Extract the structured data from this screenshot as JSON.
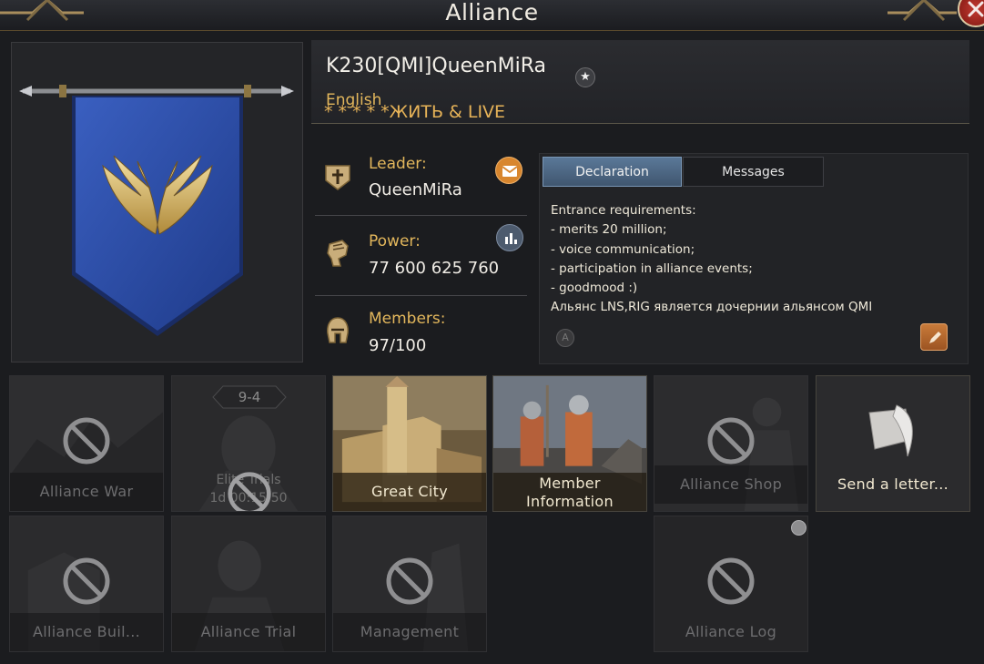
{
  "window": {
    "title": "Alliance"
  },
  "alliance": {
    "name": "K230[QMI]QueenMiRa",
    "language": "English",
    "motto": "* * * * *ЖИТЬ & LIVE"
  },
  "stats": {
    "leader_label": "Leader:",
    "leader_value": "QueenMiRa",
    "power_label": "Power:",
    "power_value": "77 600 625 760",
    "members_label": "Members:",
    "members_value": "97/100"
  },
  "info": {
    "tabs": [
      "Declaration",
      "Messages"
    ],
    "active_tab": "Declaration",
    "declaration_lines": [
      "Entrance requirements:",
      "- merits 20 million;",
      "- voice communication;",
      "- participation in alliance events;",
      "- goodmood :)",
      "Альянс LNS,RIG является дочернии альянсом QMI"
    ]
  },
  "features": [
    {
      "label": "Alliance War",
      "enabled": false
    },
    {
      "label": "Elite Trials",
      "badge": "9-4",
      "timer": "1d 00:15:50",
      "enabled": false
    },
    {
      "label": "Great City",
      "enabled": true
    },
    {
      "label": "Member Information",
      "enabled": true
    },
    {
      "label": "Alliance Shop",
      "enabled": false
    },
    {
      "label": "Send a letter...",
      "enabled": true
    },
    {
      "label": "Alliance Buil...",
      "enabled": false
    },
    {
      "label": "Alliance Trial",
      "enabled": false
    },
    {
      "label": "Management",
      "enabled": false
    },
    {
      "label": "Alliance Log",
      "enabled": false
    }
  ],
  "icons": {
    "close": "close-icon",
    "star": "star-icon",
    "leader": "leader-crest-icon",
    "mail": "mail-icon",
    "power": "fist-icon",
    "chart": "bar-chart-icon",
    "members": "helmet-icon",
    "edit": "edit-icon",
    "translate": "translate-icon",
    "locked": "prohibited-icon",
    "letter": "quill-letter-icon"
  },
  "colors": {
    "accent_gold": "#e3b75c",
    "banner_blue": "#2c4ea8",
    "tab_active": "#4f6b8a"
  }
}
